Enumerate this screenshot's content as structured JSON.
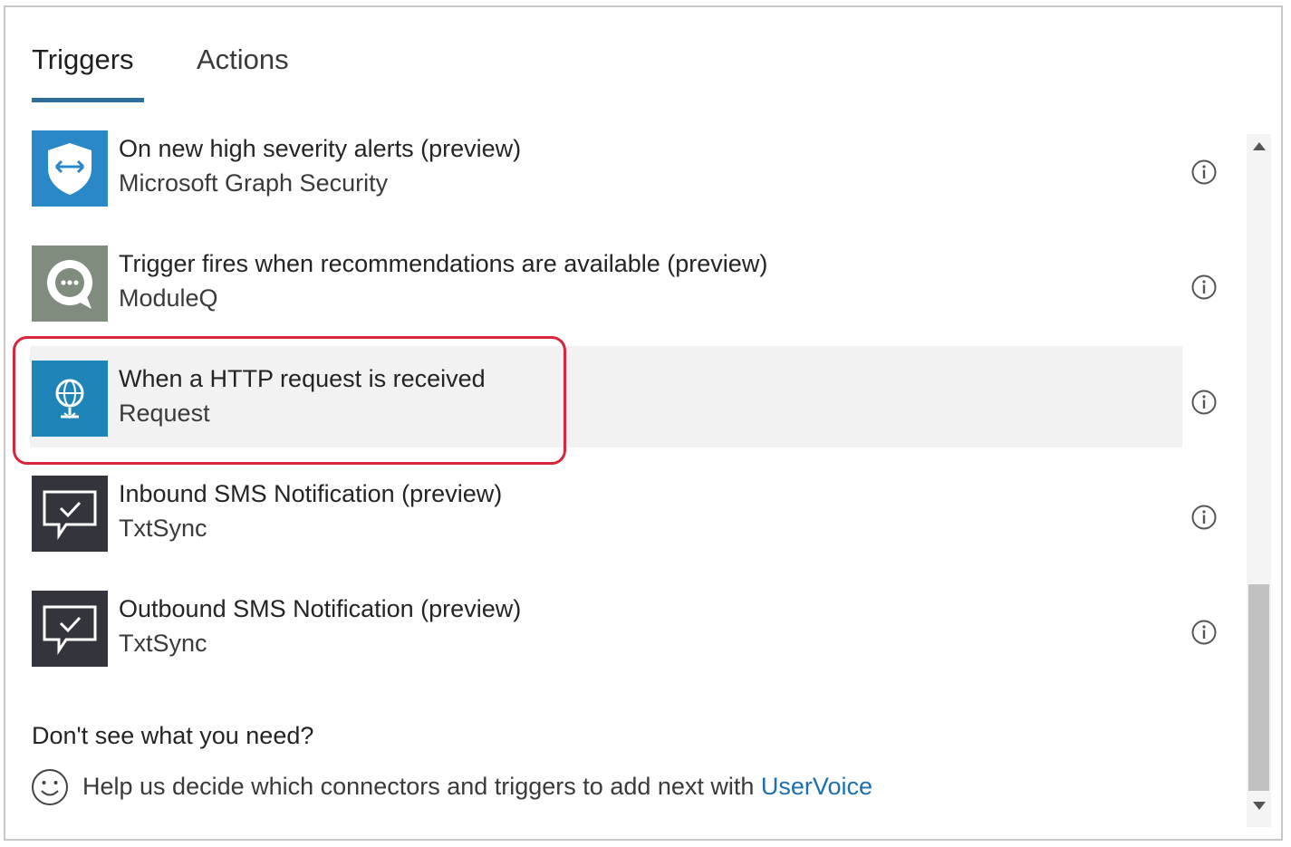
{
  "tabs": [
    {
      "label": "Triggers",
      "active": true
    },
    {
      "label": "Actions",
      "active": false
    }
  ],
  "triggers": [
    {
      "title": "On new high severity alerts (preview)",
      "subtitle": "Microsoft Graph Security",
      "icon": "shield-icon",
      "icon_bg": "#2b88c8"
    },
    {
      "title": "Trigger fires when recommendations are available (preview)",
      "subtitle": "ModuleQ",
      "icon": "chat-bubble-icon",
      "icon_bg": "#7f8c7e"
    },
    {
      "title": "When a HTTP request is received",
      "subtitle": "Request",
      "icon": "globe-request-icon",
      "icon_bg": "#1f85b8",
      "selected": true
    },
    {
      "title": "Inbound SMS Notification (preview)",
      "subtitle": "TxtSync",
      "icon": "sms-check-icon",
      "icon_bg": "#33343c"
    },
    {
      "title": "Outbound SMS Notification (preview)",
      "subtitle": "TxtSync",
      "icon": "sms-check-icon",
      "icon_bg": "#33343c"
    }
  ],
  "footer": {
    "question": "Don't see what you need?",
    "help_text": "Help us decide which connectors and triggers to add next with ",
    "link_text": "UserVoice"
  },
  "colors": {
    "accent": "#2e6c9a",
    "highlight_border": "#d7263d",
    "link": "#1c6fb0"
  }
}
